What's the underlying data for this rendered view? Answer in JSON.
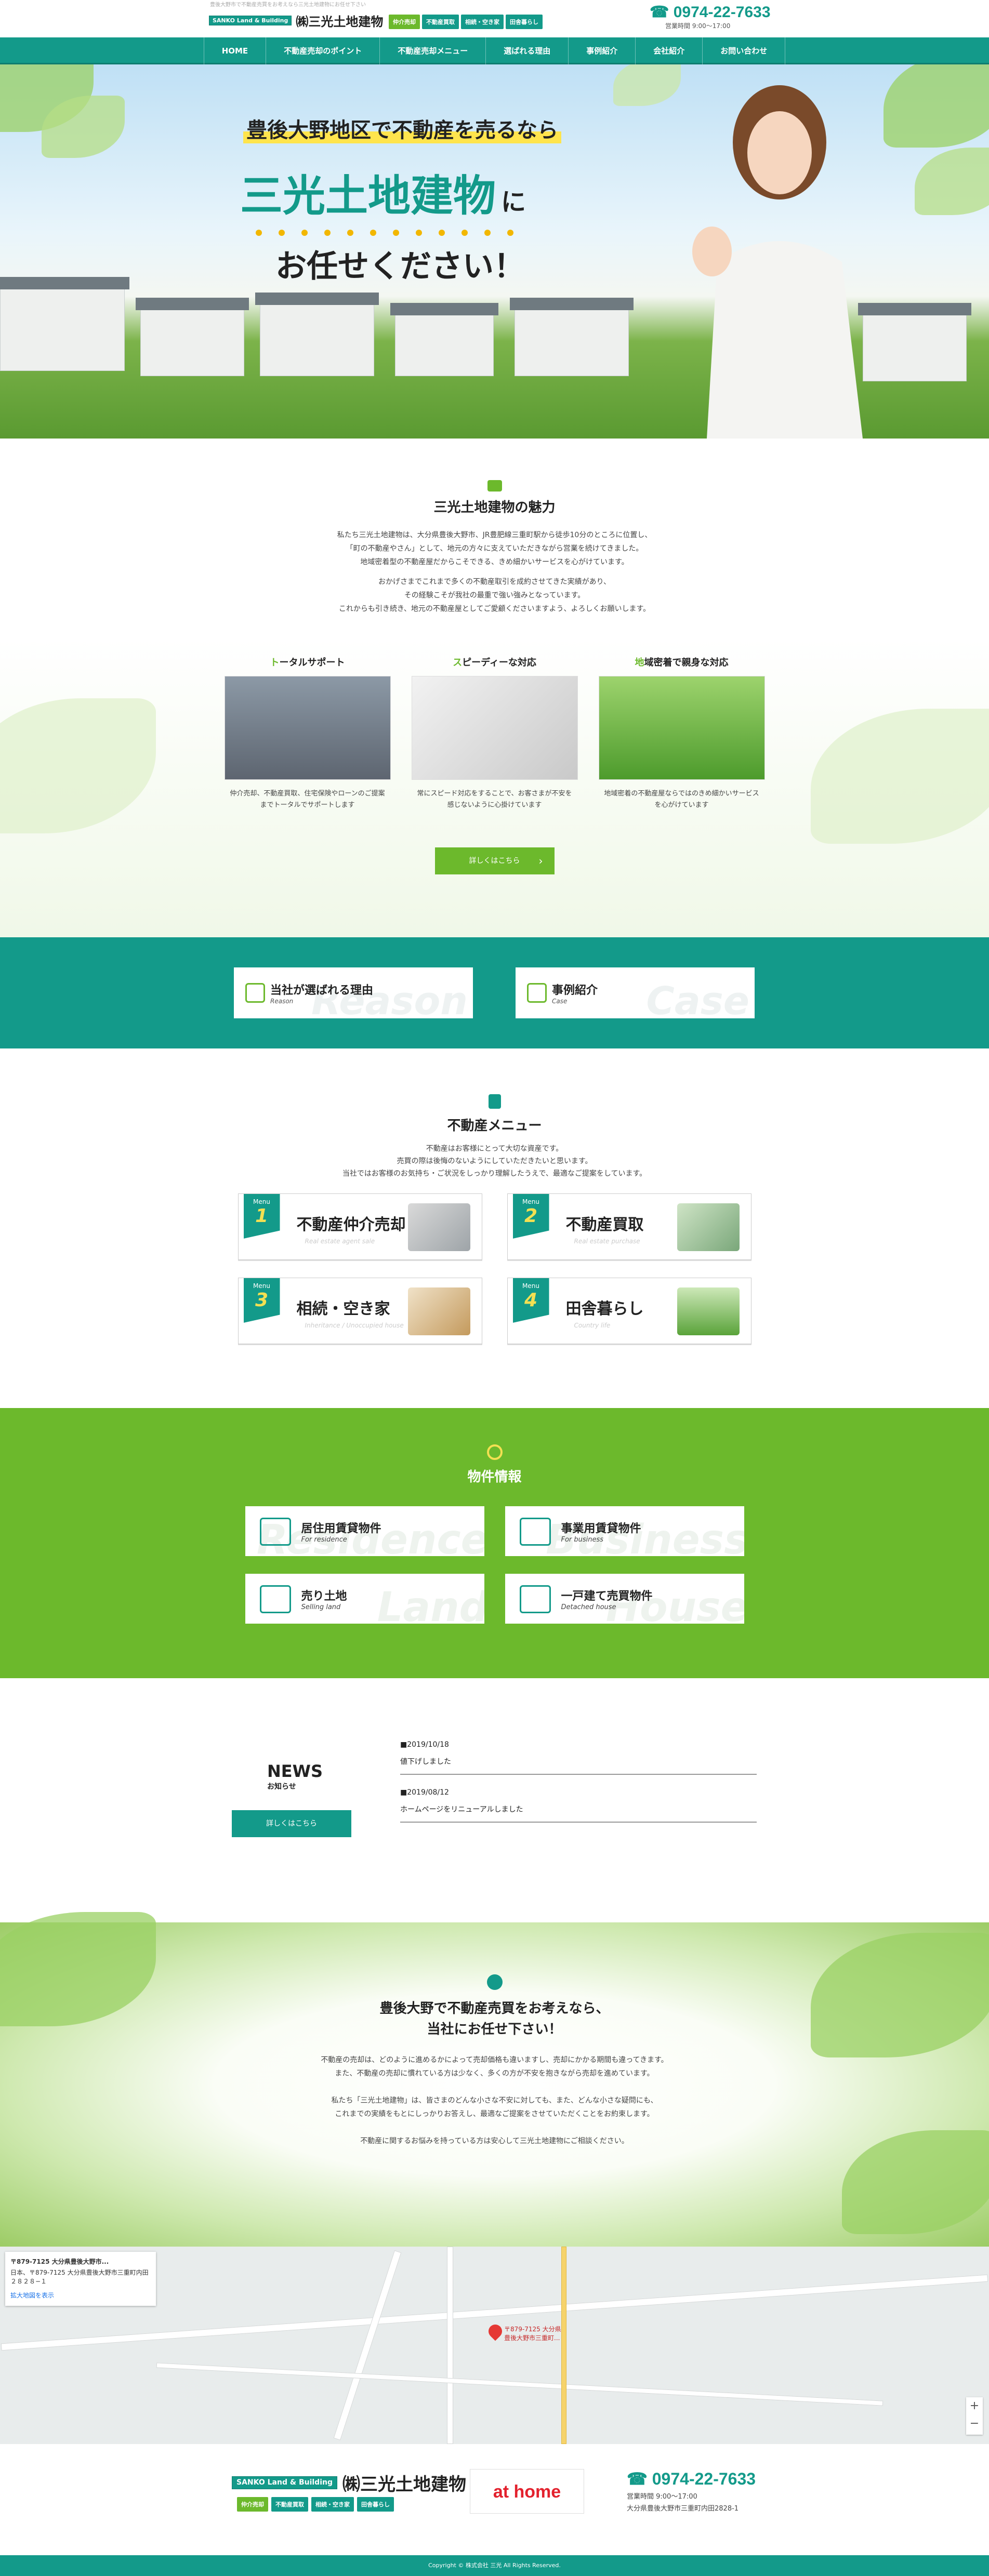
{
  "header": {
    "tagline": "豊後大野市で不動産売買をお考えなら三光土地建物にお任せ下さい",
    "logo_mark": "SANKO Land & Building",
    "logo_text": "㈱三光土地建物",
    "tags": [
      "仲介売却",
      "不動産買取",
      "相続・空き家",
      "田舎暮らし"
    ],
    "tel": "0974-22-7633",
    "hours": "営業時間 9:00～17:00"
  },
  "nav": [
    "HOME",
    "不動産売却のポイント",
    "不動産売却メニュー",
    "選ばれる理由",
    "事例紹介",
    "会社紹介",
    "お問い合わせ"
  ],
  "hero": {
    "line1": "豊後大野地区で不動産を売るなら",
    "line2": "三光土地建物",
    "line2_suffix": "に",
    "line3": "お任せください！"
  },
  "charm": {
    "title": "三光土地建物の魅力",
    "para1": [
      "私たち三光土地建物は、大分県豊後大野市、JR豊肥線三重町駅から徒歩10分のところに位置し、",
      "「町の不動産やさん」として、地元の方々に支えていただきながら営業を続けてきました。",
      "地域密着型の不動産屋だからこそできる、きめ細かいサービスを心がけています。"
    ],
    "para2": [
      "おかげさまでこれまで多くの不動産取引を成約させてきた実績があり、",
      "その経験こそが我社の最重で強い強みとなっています。",
      "これからも引き続き、地元の不動産屋としてご愛顧くださいますよう、よろしくお願いします。"
    ],
    "cards": [
      {
        "head_accent": "ト",
        "head_rest": "ータルサポート",
        "text": "仲介売却、不動産買取、住宅保険やローンのご提案までトータルでサポートします"
      },
      {
        "head_accent": "ス",
        "head_rest": "ピーディーな対応",
        "text": "常にスピード対応をすることで、お客さまが不安を感じないように心掛けています"
      },
      {
        "head_accent": "地",
        "head_rest": "域密着で親身な対応",
        "text": "地域密着の不動産屋ならではのきめ細かいサービスを心がけています"
      }
    ],
    "more": "詳しくはこちら"
  },
  "band": {
    "items": [
      {
        "title": "当社が選ばれる理由",
        "sub": "Reason",
        "bg": "Reason"
      },
      {
        "title": "事例紹介",
        "sub": "Case",
        "bg": "Case"
      }
    ]
  },
  "menu": {
    "title": "不動産メニュー",
    "para": [
      "不動産はお客様にとって大切な資産です。",
      "売買の際は後悔のないようにしていただきたいと思います。",
      "当社ではお客様のお気持ち・ご状況をしっかり理解したうえで、最適なご提案をしています。"
    ],
    "badge_label": "Menu",
    "items": [
      {
        "num": "1",
        "title": "不動産仲介売却",
        "sub": "Real estate agent sale"
      },
      {
        "num": "2",
        "title": "不動産買取",
        "sub": "Real estate purchase"
      },
      {
        "num": "3",
        "title": "相続・空き家",
        "sub": "Inheritance / Unoccupied house"
      },
      {
        "num": "4",
        "title": "田舎暮らし",
        "sub": "Country life"
      }
    ]
  },
  "property": {
    "title": "物件情報",
    "items": [
      {
        "title": "居住用賃貸物件",
        "sub": "For residence",
        "bg": "Residence"
      },
      {
        "title": "事業用賃貸物件",
        "sub": "For business",
        "bg": "Business"
      },
      {
        "title": "売り土地",
        "sub": "Selling land",
        "bg": "Land"
      },
      {
        "title": "一戸建て売買物件",
        "sub": "Detached house",
        "bg": "House"
      }
    ]
  },
  "news": {
    "title": "NEWS",
    "sub": "お知らせ",
    "button": "詳しくはこちら",
    "items": [
      {
        "date": "■2019/10/18",
        "text": "値下げしました"
      },
      {
        "date": "■2019/08/12",
        "text": "ホームページをリニューアルしました"
      }
    ]
  },
  "consult": {
    "title1": "豊後大野で不動産売買をお考えなら、",
    "title2": "当社にお任せ下さい！",
    "p1": [
      "不動産の売却は、どのように進めるかによって売却価格も違いますし、売却にかかる期間も違ってきます。",
      "また、不動産の売却に慣れている方は少なく、多くの方が不安を抱きながら売却を進めています。"
    ],
    "p2": [
      "私たち「三光土地建物」は、皆さまのどんな小さな不安に対しても、また、どんな小さな疑問にも、",
      "これまでの実績をもとにしっかりお答えし、最適なご提案をさせていただくことをお約束します。"
    ],
    "p3": [
      "不動産に関するお悩みを持っている方は安心して三光土地建物にご相談ください。"
    ]
  },
  "map": {
    "info_title": "〒879-7125 大分県豊後大野市...",
    "info_addr": "日本、〒879-7125 大分県豊後大野市三重町内田２８２８−１",
    "info_link": "拡大地図を表示",
    "pin_label": "〒879-7125 大分県豊後大野市三重町...",
    "zoom_in": "+",
    "zoom_out": "−"
  },
  "footer": {
    "logo_mark": "SANKO Land & Building",
    "logo_text": "㈱三光土地建物",
    "tags": [
      "仲介売却",
      "不動産買取",
      "相続・空き家",
      "田舎暮らし"
    ],
    "athome": "at home",
    "tel": "0974-22-7633",
    "hours": "営業時間 9:00～17:00",
    "address": "大分県豊後大野市三重町内田2828-1",
    "copyright": "Copyright © 株式会社 三光 All Rights Reserved."
  },
  "colors": {
    "teal": "#139a8a",
    "green": "#6cb92c",
    "yellow": "#f2b700"
  }
}
